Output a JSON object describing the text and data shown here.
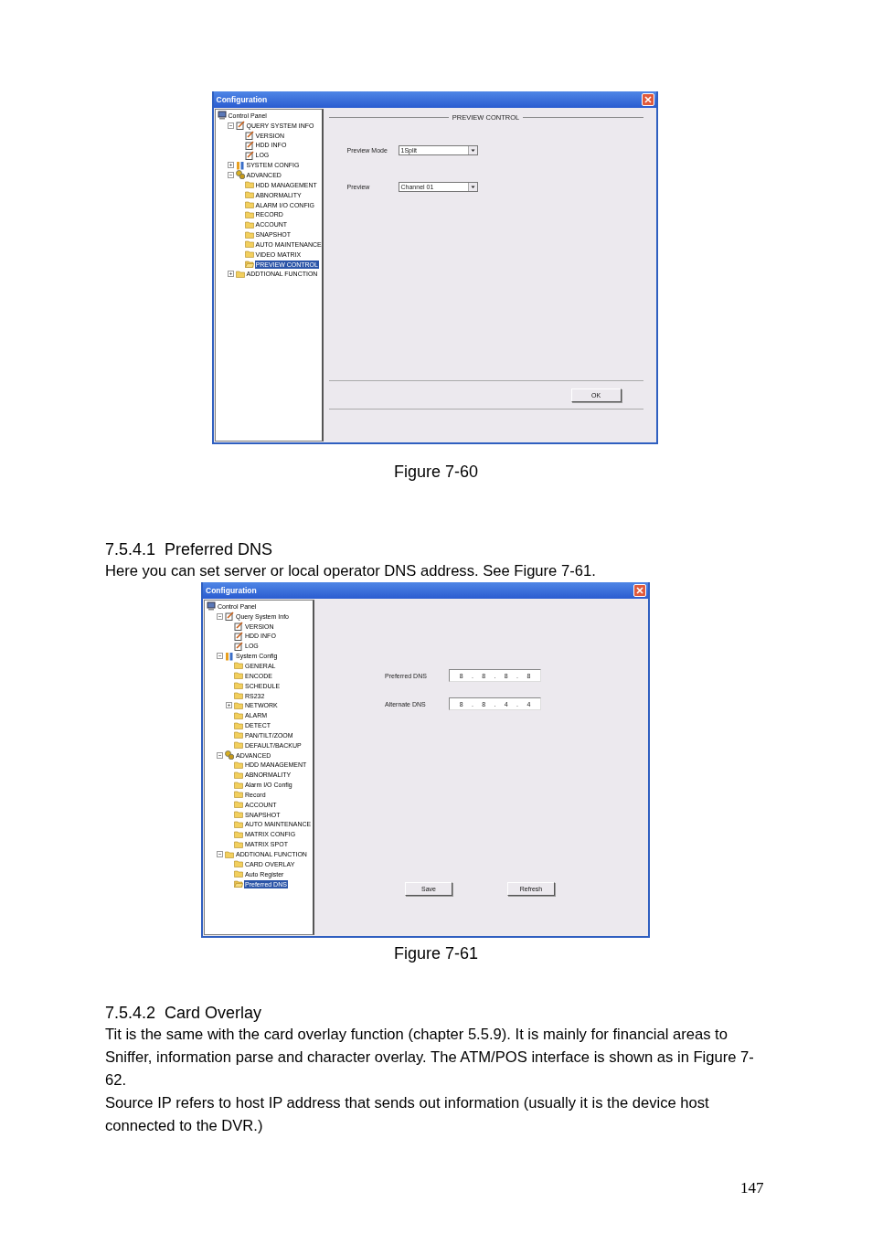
{
  "figures": [
    {
      "window": {
        "title": "Configuration"
      },
      "tree": [
        {
          "label": "Control Panel",
          "kind": "computer",
          "children": [
            {
              "label": "QUERY SYSTEM INFO",
              "kind": "note",
              "expanded": true,
              "children": [
                {
                  "label": "VERSION",
                  "kind": "note",
                  "selected": false
                },
                {
                  "label": "HDD INFO",
                  "kind": "note",
                  "selected": false
                },
                {
                  "label": "LOG",
                  "kind": "note",
                  "selected": false
                }
              ],
              "selected": false
            },
            {
              "label": "SYSTEM CONFIG",
              "kind": "tools",
              "expanded": false,
              "selected": false
            },
            {
              "label": "ADVANCED",
              "kind": "gears",
              "expanded": true,
              "selected": false,
              "children": [
                {
                  "label": "HDD MANAGEMENT",
                  "kind": "folder",
                  "selected": false
                },
                {
                  "label": "ABNORMALITY",
                  "kind": "folder",
                  "selected": false
                },
                {
                  "label": "ALARM I/O CONFIG",
                  "kind": "folder",
                  "selected": false
                },
                {
                  "label": "RECORD",
                  "kind": "folder",
                  "selected": false
                },
                {
                  "label": "ACCOUNT",
                  "kind": "folder",
                  "selected": false
                },
                {
                  "label": "SNAPSHOT",
                  "kind": "folder",
                  "selected": false
                },
                {
                  "label": "AUTO MAINTENANCE",
                  "kind": "folder",
                  "selected": false
                },
                {
                  "label": "VIDEO MATRIX",
                  "kind": "folder",
                  "selected": false
                },
                {
                  "label": "PREVIEW CONTROL",
                  "kind": "folder",
                  "selected": true
                }
              ]
            },
            {
              "label": "ADDTIONAL FUNCTION",
              "kind": "folder",
              "expanded": false,
              "selected": false
            }
          ],
          "selected": false
        }
      ],
      "panel": {
        "kind": "preview",
        "group_title": "PREVIEW CONTROL",
        "fields": [
          {
            "label": "Preview Mode",
            "value": "1Split"
          },
          {
            "label": "Preview",
            "value": "Channel 01"
          }
        ],
        "buttons": [
          "OK"
        ]
      },
      "caption": "Figure 7-60"
    },
    {
      "heading": {
        "number": "7.5.4.1",
        "title": "Preferred DNS"
      },
      "paragraphs": [
        "Here you can set server or local operator DNS address. See Figure 7-61."
      ],
      "window": {
        "title": "Configuration"
      },
      "tree": [
        {
          "label": "Control Panel",
          "kind": "computer",
          "selected": false,
          "children": [
            {
              "label": "Query System Info",
              "kind": "note",
              "expanded": true,
              "selected": false,
              "children": [
                {
                  "label": "VERSION",
                  "kind": "note",
                  "selected": false
                },
                {
                  "label": "HDD INFO",
                  "kind": "note",
                  "selected": false
                },
                {
                  "label": "LOG",
                  "kind": "note",
                  "selected": false
                }
              ]
            },
            {
              "label": "System Config",
              "kind": "tools",
              "expanded": true,
              "selected": false,
              "children": [
                {
                  "label": "GENERAL",
                  "kind": "folder",
                  "selected": false
                },
                {
                  "label": "ENCODE",
                  "kind": "folder",
                  "selected": false
                },
                {
                  "label": "SCHEDULE",
                  "kind": "folder",
                  "selected": false
                },
                {
                  "label": "RS232",
                  "kind": "folder",
                  "selected": false
                },
                {
                  "label": "NETWORK",
                  "kind": "folder",
                  "expanded": false,
                  "selected": false
                },
                {
                  "label": "ALARM",
                  "kind": "folder",
                  "selected": false
                },
                {
                  "label": "DETECT",
                  "kind": "folder",
                  "selected": false
                },
                {
                  "label": "PAN/TILT/ZOOM",
                  "kind": "folder",
                  "selected": false
                },
                {
                  "label": "DEFAULT/BACKUP",
                  "kind": "folder",
                  "selected": false
                }
              ]
            },
            {
              "label": "ADVANCED",
              "kind": "gears",
              "expanded": true,
              "selected": false,
              "children": [
                {
                  "label": "HDD MANAGEMENT",
                  "kind": "folder",
                  "selected": false
                },
                {
                  "label": "ABNORMALITY",
                  "kind": "folder",
                  "selected": false
                },
                {
                  "label": "Alarm I/O Config",
                  "kind": "folder",
                  "selected": false
                },
                {
                  "label": "Record",
                  "kind": "folder",
                  "selected": false
                },
                {
                  "label": "ACCOUNT",
                  "kind": "folder",
                  "selected": false
                },
                {
                  "label": "SNAPSHOT",
                  "kind": "folder",
                  "selected": false
                },
                {
                  "label": "AUTO MAINTENANCE",
                  "kind": "folder",
                  "selected": false
                },
                {
                  "label": "MATRIX CONFIG",
                  "kind": "folder",
                  "selected": false
                },
                {
                  "label": "MATRIX SPOT",
                  "kind": "folder",
                  "selected": false
                }
              ]
            },
            {
              "label": "ADDTIONAL FUNCTION",
              "kind": "folder",
              "expanded": true,
              "selected": false,
              "children": [
                {
                  "label": "CARD OVERLAY",
                  "kind": "folder",
                  "selected": false
                },
                {
                  "label": "Auto Register",
                  "kind": "folder",
                  "selected": false
                },
                {
                  "label": "Preferred DNS",
                  "kind": "folder",
                  "selected": true
                }
              ]
            }
          ]
        }
      ],
      "panel": {
        "kind": "dns",
        "separator": ".",
        "fields": [
          {
            "label": "Preferred DNS",
            "octets": [
              "8",
              "8",
              "8",
              "8"
            ]
          },
          {
            "label": "Alternate DNS",
            "octets": [
              "8",
              "8",
              "4",
              "4"
            ]
          }
        ],
        "buttons": [
          "Save",
          "Refresh"
        ]
      },
      "caption": "Figure 7-61"
    },
    {
      "heading": {
        "number": "7.5.4.2",
        "title": "Card Overlay"
      },
      "paragraphs": [
        "Tit is the same with the card overlay function (chapter 5.5.9). It is mainly for financial areas to Sniffer, information parse and character overlay. The ATM/POS interface is shown as in Figure 7-62.",
        "Source IP refers to host IP address that sends out information (usually it is the device host connected to the DVR.)"
      ]
    }
  ],
  "page_number": "147"
}
